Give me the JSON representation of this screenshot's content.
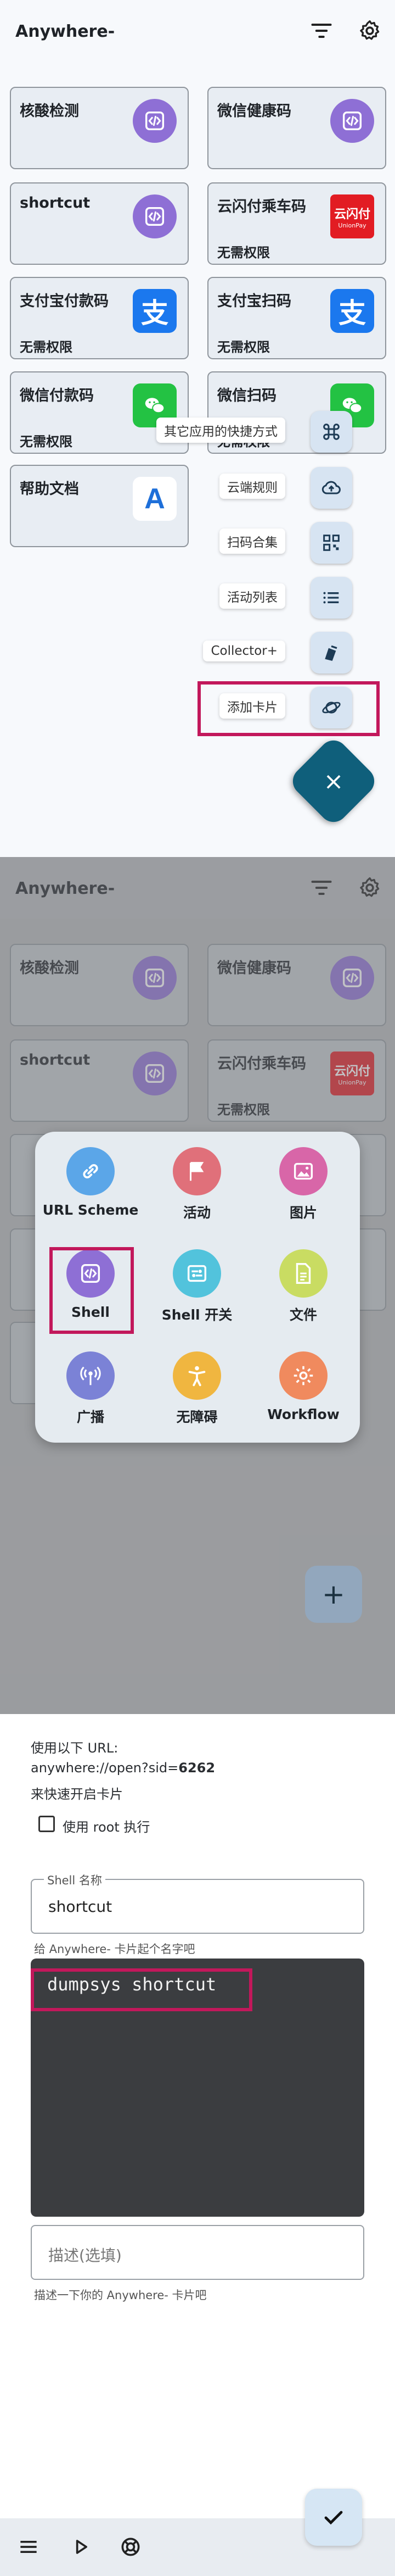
{
  "app": {
    "title": "Anywhere-"
  },
  "icons": {
    "filter": "filter-icon",
    "settings": "gear-icon"
  },
  "cards": [
    {
      "title": "核酸检测",
      "subtitle": "",
      "icon": "shell-icon"
    },
    {
      "title": "微信健康码",
      "subtitle": "",
      "icon": "shell-icon"
    },
    {
      "title": "shortcut",
      "subtitle": "",
      "icon": "shell-icon"
    },
    {
      "title": "云闪付乘车码",
      "subtitle": "无需权限",
      "icon": "unionpay-icon",
      "icon_text": "云闪付",
      "icon_subtext": "UnionPay"
    },
    {
      "title": "支付宝付款码",
      "subtitle": "无需权限",
      "icon": "alipay-icon",
      "icon_text": "支"
    },
    {
      "title": "支付宝扫码",
      "subtitle": "无需权限",
      "icon": "alipay-icon",
      "icon_text": "支"
    },
    {
      "title": "微信付款码",
      "subtitle": "无需权限",
      "icon": "wechat-icon"
    },
    {
      "title": "微信扫码",
      "subtitle": "无需权限",
      "icon": "wechat-icon"
    },
    {
      "title": "帮助文档",
      "subtitle": "",
      "icon": "help-doc-icon",
      "icon_text": "A"
    }
  ],
  "fab_menu": [
    {
      "label": "其它应用的快捷方式",
      "icon": "command-icon"
    },
    {
      "label": "云端规则",
      "icon": "cloud-upload-icon"
    },
    {
      "label": "扫码合集",
      "icon": "qr-code-icon"
    },
    {
      "label": "活动列表",
      "icon": "list-icon"
    },
    {
      "label": "Collector+",
      "icon": "collector-icon"
    },
    {
      "label": "添加卡片",
      "icon": "planet-icon"
    }
  ],
  "fab_close": "×",
  "type_picker": [
    {
      "label": "URL Scheme",
      "color": "#5ba6e8",
      "icon": "link-icon"
    },
    {
      "label": "活动",
      "color": "#e0707a",
      "icon": "flag-icon"
    },
    {
      "label": "图片",
      "color": "#d866a8",
      "icon": "image-icon"
    },
    {
      "label": "Shell",
      "color": "#8e6fd5",
      "icon": "shell-icon"
    },
    {
      "label": "Shell 开关",
      "color": "#52c3dc",
      "icon": "switch-icon"
    },
    {
      "label": "文件",
      "color": "#c9dc62",
      "icon": "file-icon"
    },
    {
      "label": "广播",
      "color": "#7b82d6",
      "icon": "broadcast-icon"
    },
    {
      "label": "无障碍",
      "color": "#f0b640",
      "icon": "accessibility-icon"
    },
    {
      "label": "Workflow",
      "color": "#f08a5e",
      "icon": "workflow-icon"
    }
  ],
  "add_fab": "+",
  "editor": {
    "url_intro": "使用以下 URL:",
    "url_prefix": "anywhere://open?sid=",
    "url_sid": "6262",
    "url_suffix": "来快速开启卡片",
    "root_checkbox_label": "使用 root 执行",
    "name_label": "Shell 名称",
    "name_value": "shortcut",
    "name_helper": "给 Anywhere- 卡片起个名字吧",
    "command": "dumpsys shortcut",
    "desc_placeholder": "描述(选填)",
    "desc_helper": "描述一下你的 Anywhere- 卡片吧"
  },
  "bottom_bar": {
    "icons": [
      "menu-icon",
      "play-icon",
      "lifebuoy-icon"
    ]
  },
  "colors": {
    "highlight": "#c2185b",
    "fab": "#0f5f7b",
    "card_bg": "#e8edf3"
  }
}
